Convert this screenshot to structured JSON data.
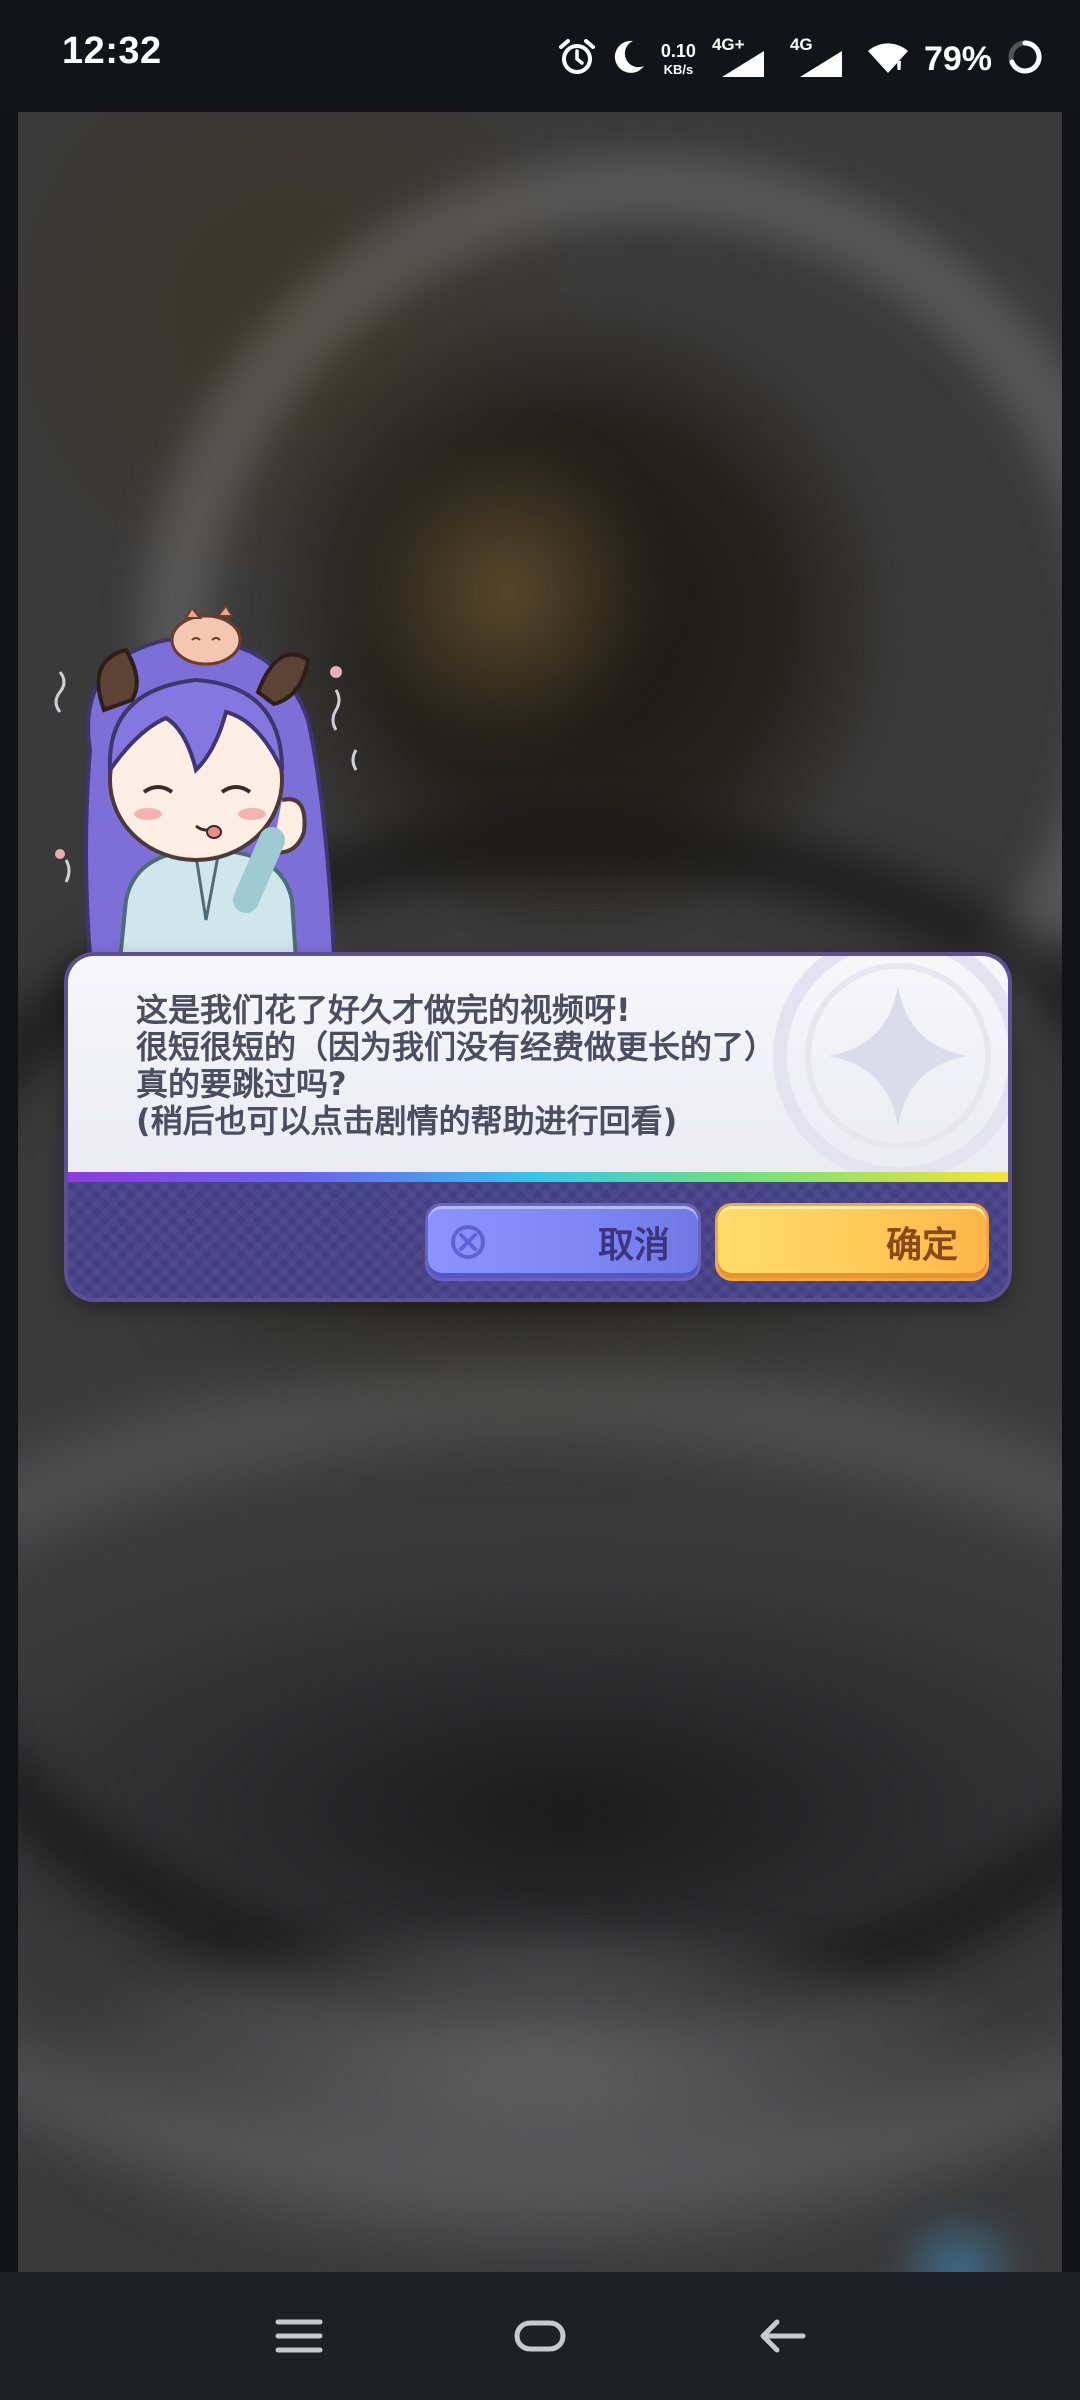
{
  "status_bar": {
    "time": "12:32",
    "net_speed_value": "0.10",
    "net_speed_unit": "KB/s",
    "sim1_label": "4G+",
    "sim2_label": "4G",
    "battery": "79%",
    "icons": [
      "alarm-icon",
      "moon-icon",
      "signal-icon",
      "signal-icon",
      "wifi-icon",
      "battery-ring-icon"
    ]
  },
  "dialog": {
    "lines": [
      "这是我们花了好久才做完的视频呀!",
      "很短很短的（因为我们没有经费做更长的了）",
      "真的要跳过吗?",
      "(稍后也可以点击剧情的帮助进行回看)"
    ],
    "cancel_label": "取消",
    "confirm_label": "确定",
    "colors": {
      "cancel": "#7f88f6",
      "confirm": "#ffcb5a",
      "panel": "#433d84",
      "text": "#4d4d60"
    }
  },
  "nav_bar": {
    "icons": [
      "menu-icon",
      "home-icon",
      "back-icon"
    ]
  }
}
